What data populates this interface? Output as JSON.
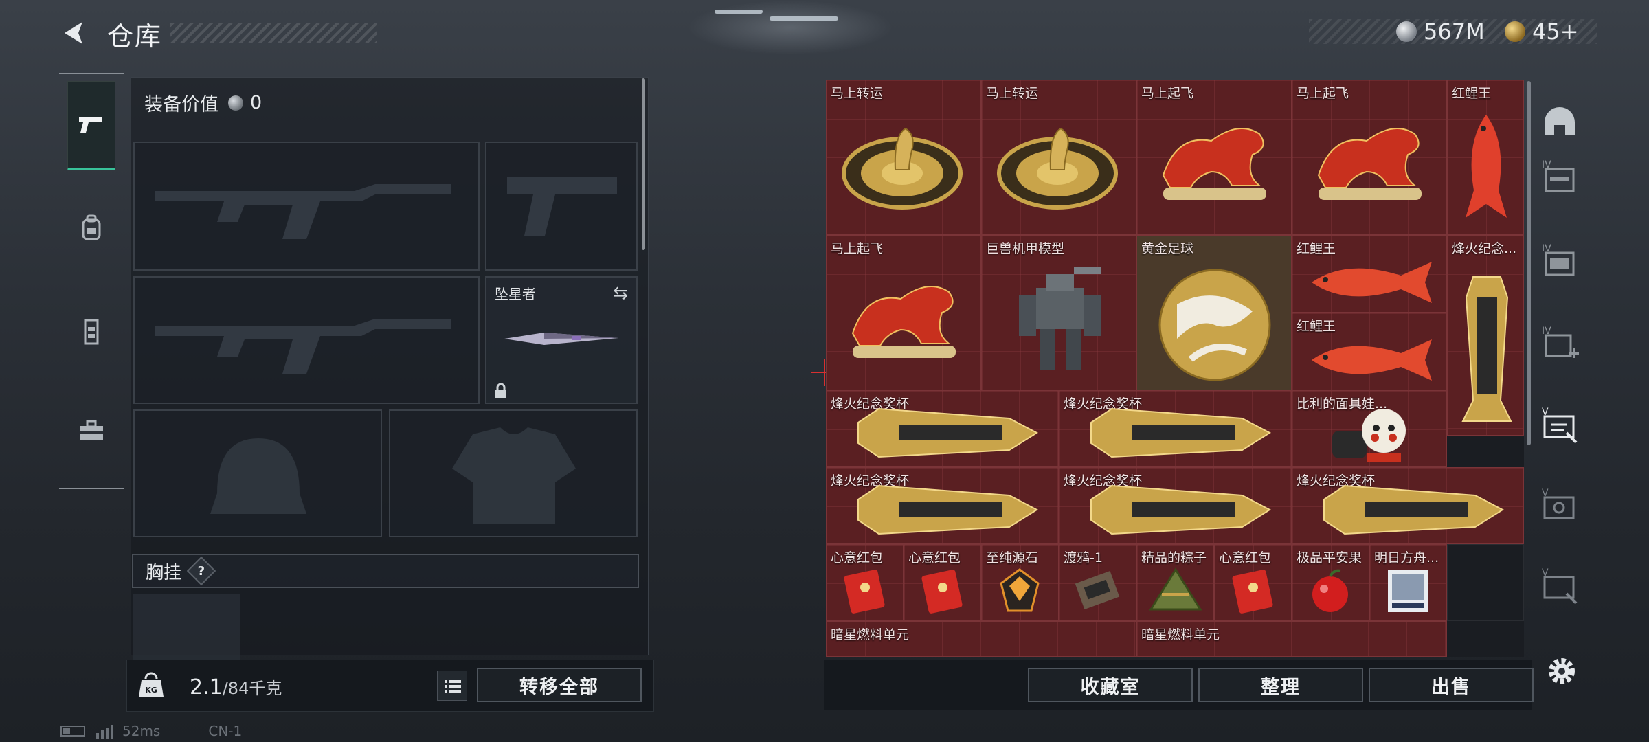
{
  "header": {
    "title": "仓库",
    "currency_silver": "567M",
    "currency_gold": "45+"
  },
  "colors": {
    "accent": "#38c39a",
    "cell_red": "#5a1f22",
    "gold": "#c9a44a"
  },
  "tabs": [
    {
      "icon": "pistol-icon",
      "active": true
    },
    {
      "icon": "backpack-icon",
      "active": false
    },
    {
      "icon": "vest-icon",
      "active": false
    },
    {
      "icon": "toolbox-icon",
      "active": false
    }
  ],
  "equipment": {
    "value_label": "装备价值",
    "value": "0",
    "melee_slot_label": "坠星者",
    "chest_rig_label": "胸挂",
    "chest_rig_help": "?"
  },
  "footer_left": {
    "weight_current": "2.1",
    "weight_max": "/84千克",
    "kg_label": "KG",
    "transfer_all": "转移全部"
  },
  "footer_right": {
    "collection": "收藏室",
    "sort": "整理",
    "sell": "出售"
  },
  "items": [
    {
      "label": "马上转运",
      "icon": "gold-horse-dial-icon"
    },
    {
      "label": "马上转运",
      "icon": "gold-horse-dial-icon"
    },
    {
      "label": "马上起飞",
      "icon": "red-horse-icon"
    },
    {
      "label": "马上起飞",
      "icon": "red-horse-icon"
    },
    {
      "label": "红鲤王",
      "icon": "red-carp-icon"
    },
    {
      "label": "马上起飞",
      "icon": "red-horse-icon"
    },
    {
      "label": "巨兽机甲模型",
      "icon": "mech-model-icon"
    },
    {
      "label": "黄金足球",
      "icon": "golden-football-icon"
    },
    {
      "label": "红鲤王",
      "icon": "red-carp-icon"
    },
    {
      "label": "烽火纪念...",
      "icon": "trophy-pillar-icon"
    },
    {
      "label": "红鲤王",
      "icon": "red-carp-icon"
    },
    {
      "label": "烽火纪念奖杯",
      "icon": "trophy-icon"
    },
    {
      "label": "烽火纪念奖杯",
      "icon": "trophy-icon"
    },
    {
      "label": "比利的面具娃...",
      "icon": "billy-doll-icon"
    },
    {
      "label": "烽火纪念奖杯",
      "icon": "trophy-icon"
    },
    {
      "label": "烽火纪念奖杯",
      "icon": "trophy-icon"
    },
    {
      "label": "烽火纪念奖杯",
      "icon": "trophy-icon"
    },
    {
      "label": "心意红包",
      "icon": "red-envelope-icon"
    },
    {
      "label": "心意红包",
      "icon": "red-envelope-icon"
    },
    {
      "label": "至纯源石",
      "icon": "crystal-icon"
    },
    {
      "label": "渡鸦-1",
      "icon": "chip-icon"
    },
    {
      "label": "精品的粽子",
      "icon": "zongzi-icon"
    },
    {
      "label": "心意红包",
      "icon": "red-envelope-icon"
    },
    {
      "label": "极品平安果",
      "icon": "apple-icon"
    },
    {
      "label": "明日方舟...",
      "icon": "card-icon"
    },
    {
      "label": "暗星燃料单元",
      "icon": "fuel-cell-icon"
    },
    {
      "label": "暗星燃料单元",
      "icon": "fuel-cell-icon"
    }
  ],
  "right_rail": [
    {
      "icon": "helmet-icon"
    },
    {
      "icon": "iv-chest-rig-icon"
    },
    {
      "icon": "iv-backpack-icon"
    },
    {
      "icon": "iv-medkit-icon"
    },
    {
      "icon": "v-armor-icon"
    },
    {
      "icon": "v-armor-icon-2"
    },
    {
      "icon": "v-armor-icon-3"
    }
  ],
  "status": {
    "ping": "52ms",
    "extra": "CN-1"
  }
}
